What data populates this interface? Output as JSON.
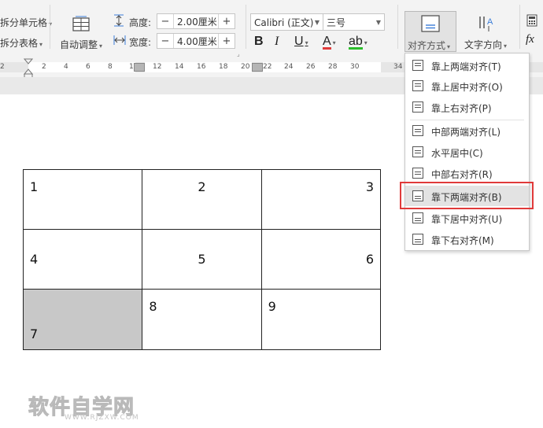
{
  "ribbon": {
    "split_cells": "拆分单元格",
    "split_table": "拆分表格",
    "auto_fit": "自动调整",
    "height_label": "高度:",
    "height_value": "2.00厘米",
    "width_label": "宽度:",
    "width_value": "4.00厘米",
    "minus": "−",
    "plus": "+",
    "font_name": "Calibri (正文)",
    "font_size": "三号",
    "bold": "B",
    "italic": "I",
    "underline": "U",
    "font_color": "A",
    "highlight": "ab",
    "align_button": "对齐方式",
    "text_direction": "文字方向",
    "formula": "fx"
  },
  "ruler": {
    "numbers": [
      "2",
      "2",
      "4",
      "6",
      "8",
      "10",
      "12",
      "14",
      "16",
      "18",
      "20",
      "22",
      "24",
      "26",
      "28",
      "30",
      "34"
    ]
  },
  "table": {
    "rows": [
      [
        "1",
        "2",
        "3"
      ],
      [
        "4",
        "5",
        "6"
      ],
      [
        "7",
        "8",
        "9"
      ]
    ]
  },
  "align_menu": {
    "items": [
      "靠上两端对齐(T)",
      "靠上居中对齐(O)",
      "靠上右对齐(P)",
      "中部两端对齐(L)",
      "水平居中(C)",
      "中部右对齐(R)",
      "靠下两端对齐(B)",
      "靠下居中对齐(U)",
      "靠下右对齐(M)"
    ],
    "highlighted_index": 6
  },
  "watermark": {
    "main": "软件自学网",
    "sub": "WWW.RJZXW.COM"
  },
  "colors": {
    "highlight_box": "#e03a3a",
    "selected_cell": "#c8c8c8",
    "font_color_bar": "#e03a3a",
    "highlight_bar": "#2bbd2b"
  }
}
